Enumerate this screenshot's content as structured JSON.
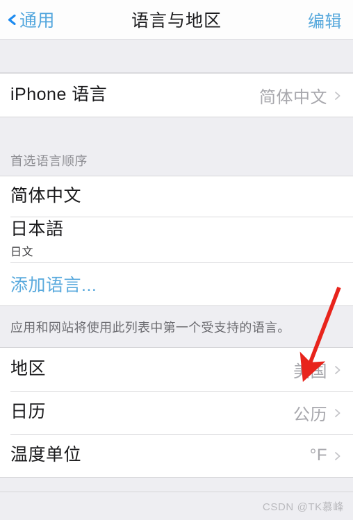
{
  "navbar": {
    "back_label": "通用",
    "back_icon": "chevron-left-icon",
    "title": "语言与地区",
    "edit_label": "编辑"
  },
  "iphone_language_section": {
    "rows": [
      {
        "label": "iPhone 语言",
        "value": "简体中文",
        "accessory": "chevron-right-icon"
      }
    ]
  },
  "preferred_order_section": {
    "header": "首选语言顺序",
    "rows": [
      {
        "label": "简体中文",
        "sub": ""
      },
      {
        "label": "日本語",
        "sub": "日文"
      }
    ],
    "add_language_label": "添加语言...",
    "footer": "应用和网站将使用此列表中第一个受支持的语言。"
  },
  "region_section": {
    "rows": [
      {
        "label": "地区",
        "value": "美国",
        "accessory": "chevron-right-icon"
      },
      {
        "label": "日历",
        "value": "公历",
        "accessory": "chevron-right-icon"
      },
      {
        "label": "温度单位",
        "value": "°F",
        "accessory": "chevron-right-icon"
      }
    ]
  },
  "annotation": {
    "type": "red-arrow",
    "color": "#e8241c",
    "points_to": "地区"
  },
  "watermark": {
    "text": "CSDN @TK慕峰"
  },
  "colors": {
    "tint_blue": "#5aaadd",
    "chevron_blue": "#1d8bf0",
    "value_gray": "#a8a8ad",
    "group_bg": "#ffffff",
    "page_bg": "#eeeef2",
    "annotation_red": "#e8241c"
  }
}
